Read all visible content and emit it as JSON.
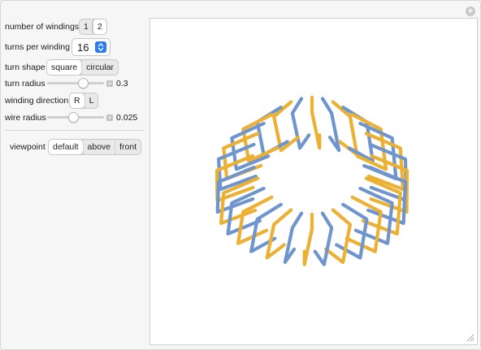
{
  "controls": {
    "windings": {
      "label": "number of windings",
      "options": [
        "1",
        "2"
      ],
      "selected": "2"
    },
    "turns": {
      "label": "turns per winding",
      "value": "16"
    },
    "shape": {
      "label": "turn shape",
      "options": [
        "square",
        "circular"
      ],
      "selected": "square"
    },
    "turn_radius": {
      "label": "turn radius",
      "value": "0.3",
      "fraction": 0.62
    },
    "direction": {
      "label": "winding direction",
      "options": [
        "R",
        "L"
      ],
      "selected": "R"
    },
    "wire_radius": {
      "label": "wire radius",
      "value": "0.025",
      "fraction": 0.45
    },
    "viewpoint": {
      "label": "viewpoint",
      "options": [
        "default",
        "above",
        "front"
      ],
      "selected": "default"
    }
  },
  "plot": {
    "winding_colors": [
      "#ecb033",
      "#6f95cf"
    ],
    "turns_per_winding": 16
  },
  "icons": {
    "corner": "plus-icon",
    "select_arrow": "updown-chevron-icon",
    "resize": "resize-grip-icon"
  }
}
